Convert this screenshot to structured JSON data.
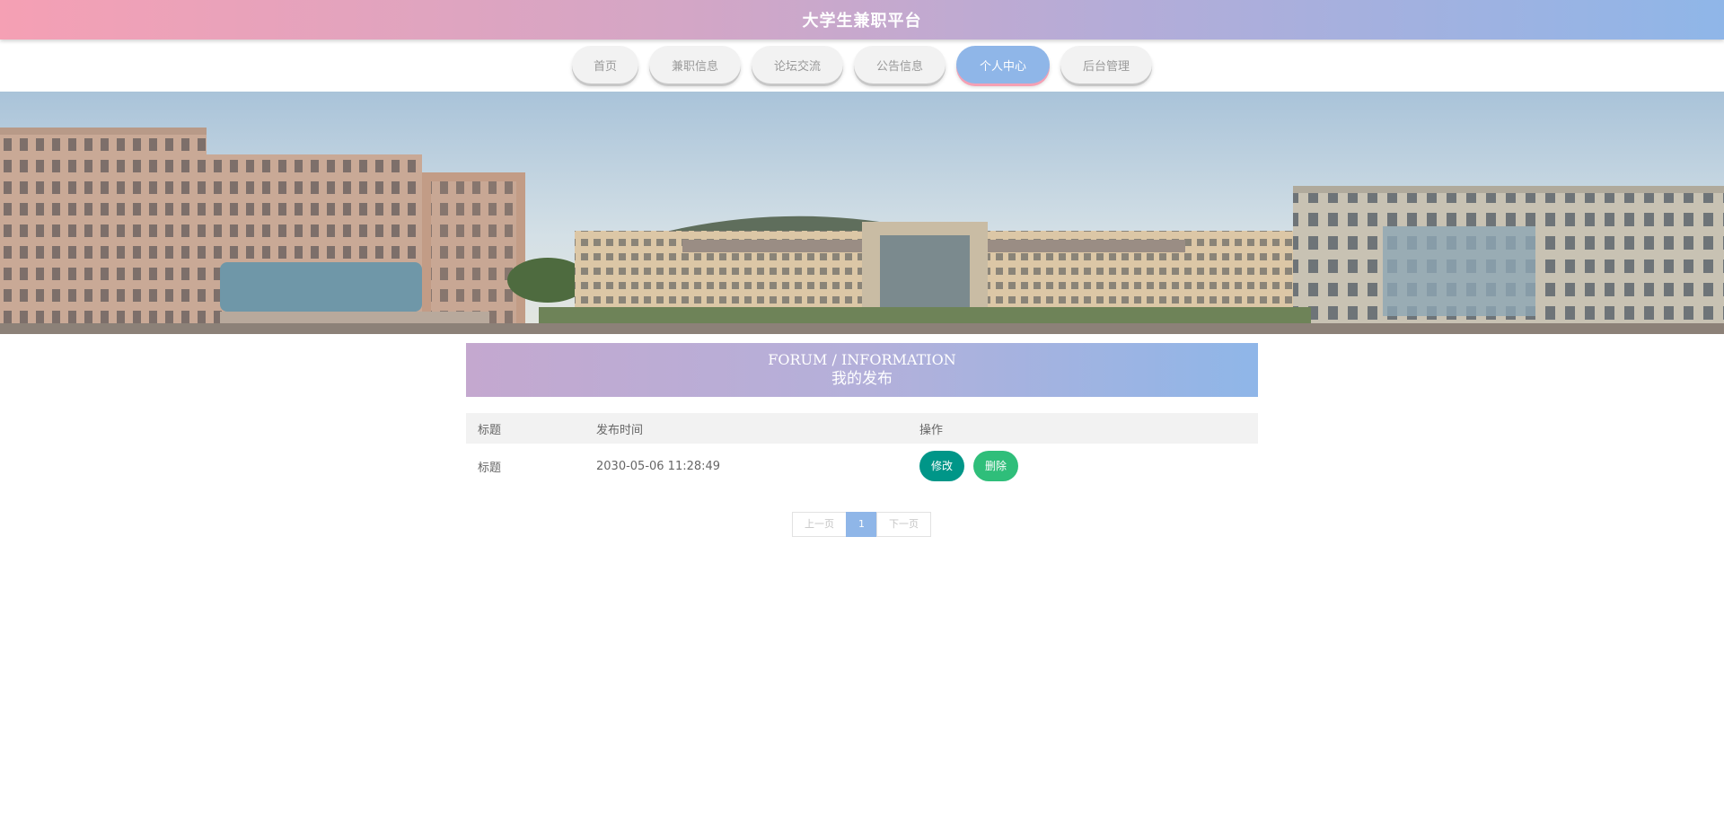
{
  "header": {
    "title": "大学生兼职平台"
  },
  "nav": {
    "items": [
      {
        "label": "首页"
      },
      {
        "label": "兼职信息"
      },
      {
        "label": "论坛交流"
      },
      {
        "label": "公告信息"
      },
      {
        "label": "个人中心"
      },
      {
        "label": "后台管理"
      }
    ],
    "active_index": 4
  },
  "section": {
    "title_en": "FORUM / INFORMATION",
    "title_cn": "我的发布"
  },
  "table": {
    "headers": [
      "标题",
      "发布时间",
      "操作"
    ],
    "rows": [
      {
        "title": "标题",
        "time": "2030-05-06 11:28:49",
        "edit_label": "修改",
        "delete_label": "删除"
      }
    ]
  },
  "pagination": {
    "prev_label": "上一页",
    "current_page": "1",
    "next_label": "下一页"
  },
  "colors": {
    "accent_blue": "#8fb6e8",
    "accent_pink": "#f5a0b4",
    "edit_button": "#009688",
    "delete_button": "#2fbe7a"
  }
}
